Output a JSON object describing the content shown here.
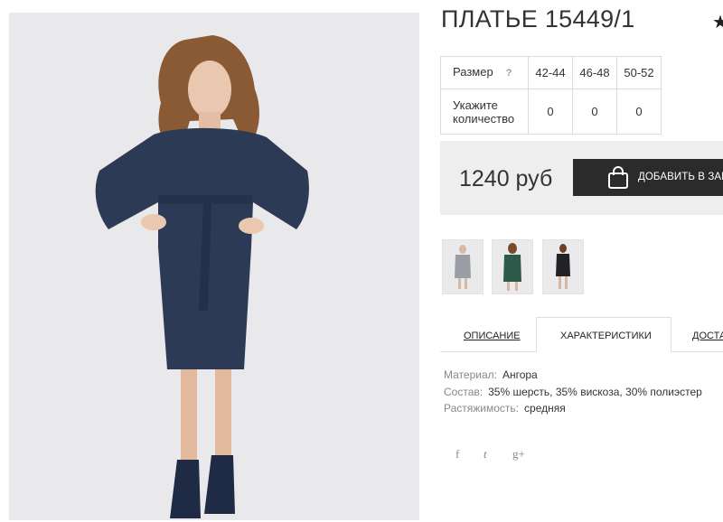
{
  "product": {
    "title": "ПЛАТЬЕ 15449/1",
    "favorite_icon": "star-icon"
  },
  "size_table": {
    "size_label": "Размер",
    "help_mark": "?",
    "sizes": [
      "42-44",
      "46-48",
      "50-52"
    ],
    "qty_label_line1": "Укажите",
    "qty_label_line2": "количество",
    "quantities": [
      "0",
      "0",
      "0"
    ]
  },
  "buy": {
    "price": "1240 руб",
    "add_to_cart_label": "ДОБАВИТЬ В ЗАК",
    "cart_icon": "shopping-bag-icon"
  },
  "thumbnails": [
    {
      "name": "grey-dress",
      "color": "#9a9ea4"
    },
    {
      "name": "green-dress",
      "color": "#2e5a4c"
    },
    {
      "name": "black-dress",
      "color": "#222226"
    }
  ],
  "tabs": {
    "description": "ОПИСАНИЕ",
    "characteristics": "ХАРАКТЕРИСТИКИ",
    "delivery": "ДОСТА"
  },
  "specs": {
    "material_key": "Материал:",
    "material_val": "Ангора",
    "composition_key": "Состав:",
    "composition_val": "35% шерсть, 35% вискоза, 30% полиэстер",
    "stretch_key": "Растяжимость:",
    "stretch_val": "средняя"
  },
  "social": {
    "facebook": "f",
    "twitter": "t",
    "googleplus": "g+"
  },
  "colors": {
    "accent_dark": "#2b2b2b",
    "price_bg": "#eeeeee",
    "dress": "#2d3a55"
  }
}
